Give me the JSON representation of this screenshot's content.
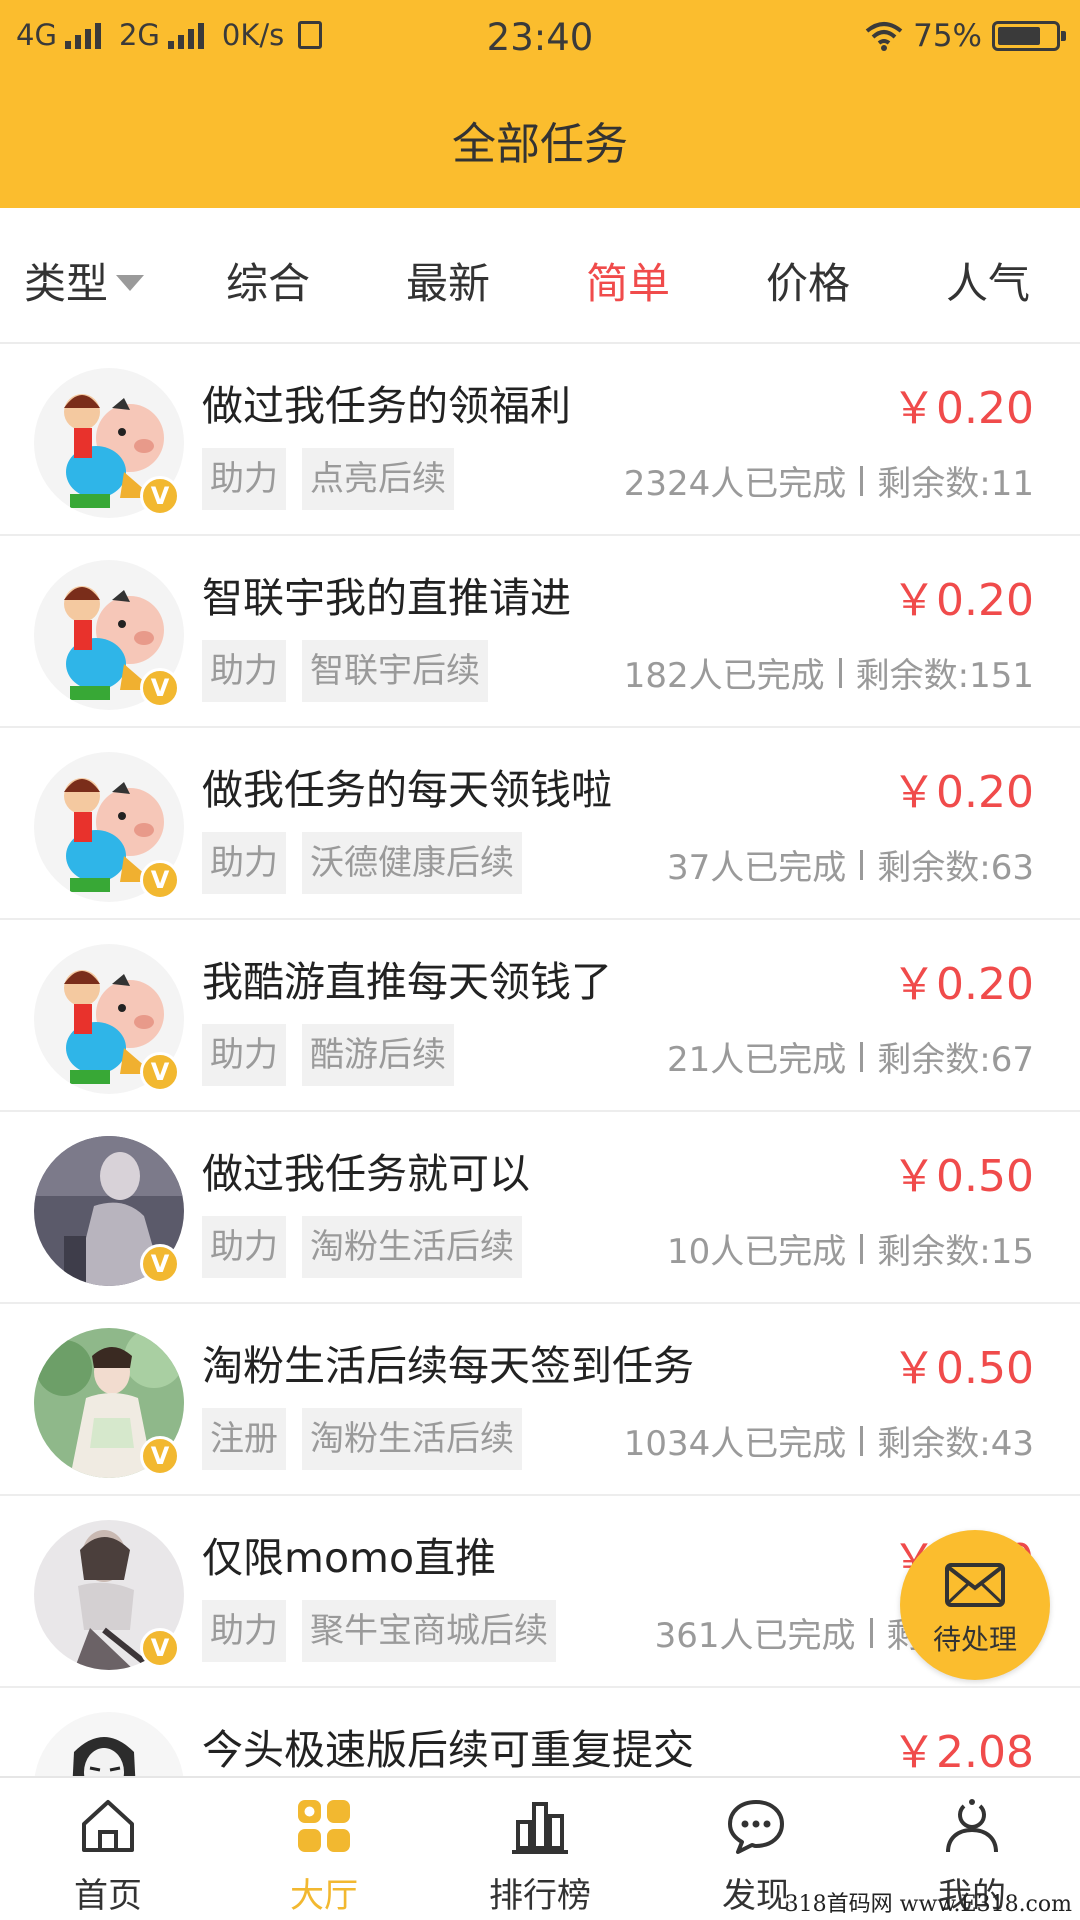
{
  "status_bar": {
    "network1": "4G",
    "network2": "2G",
    "speed": "0K/s",
    "time": "23:40",
    "battery": "75%",
    "battery_level": 0.75
  },
  "header": {
    "title": "全部任务"
  },
  "filters": {
    "type_label": "类型",
    "items": [
      "综合",
      "最新",
      "简单",
      "价格",
      "人气"
    ],
    "active": "简单"
  },
  "tasks": [
    {
      "title": "做过我任务的领福利",
      "price": "￥0.20",
      "tags": [
        "助力",
        "点亮后续"
      ],
      "completed": "2324人已完成",
      "remaining": "剩余数:11",
      "avatar": "cartoon-pig",
      "badge": "V"
    },
    {
      "title": "智联宇我的直推请进",
      "price": "￥0.20",
      "tags": [
        "助力",
        "智联宇后续"
      ],
      "completed": "182人已完成",
      "remaining": "剩余数:151",
      "avatar": "cartoon-pig",
      "badge": "V"
    },
    {
      "title": "做我任务的每天领钱啦",
      "price": "￥0.20",
      "tags": [
        "助力",
        "沃德健康后续"
      ],
      "completed": "37人已完成",
      "remaining": "剩余数:63",
      "avatar": "cartoon-pig",
      "badge": "V"
    },
    {
      "title": "我酷游直推每天领钱了",
      "price": "￥0.20",
      "tags": [
        "助力",
        "酷游后续"
      ],
      "completed": "21人已完成",
      "remaining": "剩余数:67",
      "avatar": "cartoon-pig",
      "badge": "V"
    },
    {
      "title": "做过我任务就可以",
      "price": "￥0.50",
      "tags": [
        "助力",
        "淘粉生活后续"
      ],
      "completed": "10人已完成",
      "remaining": "剩余数:15",
      "avatar": "photo-dark",
      "badge": "V"
    },
    {
      "title": "淘粉生活后续每天签到任务",
      "price": "￥0.50",
      "tags": [
        "注册",
        "淘粉生活后续"
      ],
      "completed": "1034人已完成",
      "remaining": "剩余数:43",
      "avatar": "photo-green",
      "badge": "V"
    },
    {
      "title": "仅限momo直推",
      "price": "￥0.50",
      "tags": [
        "助力",
        "聚牛宝商城后续"
      ],
      "completed": "361人已完成",
      "remaining": "剩余数:—",
      "avatar": "photo-grey",
      "badge": "V"
    },
    {
      "title": "今头极速版后续可重复提交",
      "price": "￥2.08",
      "tags": [],
      "completed": "",
      "remaining": "",
      "avatar": "sketch",
      "badge": ""
    }
  ],
  "floating_button": {
    "label": "待处理",
    "icon": "mail-icon"
  },
  "bottom_nav": {
    "items": [
      {
        "label": "首页",
        "icon": "home-icon"
      },
      {
        "label": "大厅",
        "icon": "grid-icon"
      },
      {
        "label": "排行榜",
        "icon": "bar-chart-icon"
      },
      {
        "label": "发现",
        "icon": "chat-bubble-icon"
      },
      {
        "label": "我的",
        "icon": "person-icon"
      }
    ],
    "active": "大厅"
  },
  "colors": {
    "header": "#fbbd2e",
    "accent_red": "#f04b4b",
    "nav_active": "#f2b830"
  },
  "watermark": "318首码网  www.E318.com"
}
